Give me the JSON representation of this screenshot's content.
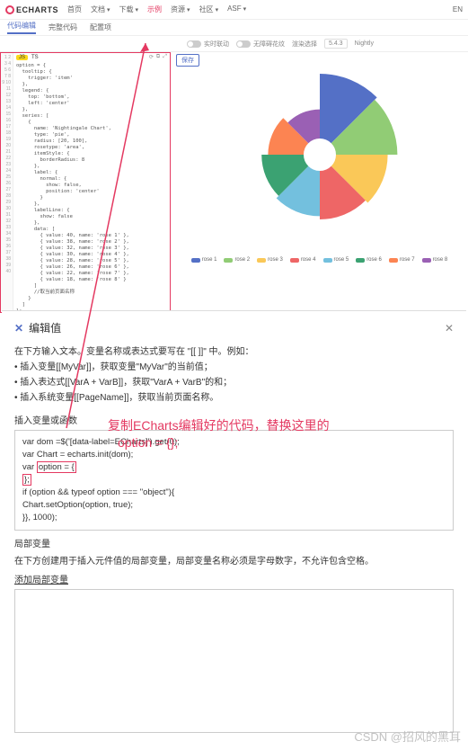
{
  "logo": "ECHARTS",
  "nav": {
    "home": "首页",
    "docs": "文档",
    "docs_dd": true,
    "download": "下载",
    "dl_dd": true,
    "examples": "示例",
    "resources": "资源",
    "res_dd": true,
    "community": "社区",
    "comm_dd": true,
    "asf": "ASF",
    "asf_dd": true
  },
  "lang": "EN",
  "subtabs": {
    "edit": "代码编辑",
    "fullcode": "完整代码",
    "options": "配置项"
  },
  "optbar": {
    "interval": "实时联动",
    "decal": "无障碍花纹",
    "render": "渲染选择",
    "version": "5.4.3",
    "channel": "Nightly"
  },
  "render_opt": "保存",
  "editor": {
    "tabs": {
      "js": "JS",
      "ts": "TS"
    },
    "lines": 40,
    "code": "option = {\n  tooltip: {\n    trigger: 'item'\n  },\n  legend: {\n    top: 'bottom',\n    left: 'center'\n  },\n  series: [\n    {\n      name: 'Nightingale Chart',\n      type: 'pie',\n      radius: [20, 100],\n      rosetype: 'area',\n      itemStyle: {\n        borderRadius: 8\n      },\n      label: {\n        normal: {\n          show: false,\n          position: 'center'\n        }\n      },\n      labelLine: {\n        show: false\n      },\n      data: [\n        { value: 40, name: 'rose 1' },\n        { value: 38, name: 'rose 2' },\n        { value: 32, name: 'rose 3' },\n        { value: 30, name: 'rose 4' },\n        { value: 28, name: 'rose 5' },\n        { value: 26, name: 'rose 6' },\n        { value: 22, name: 'rose 7' },\n        { value: 18, name: 'rose 8' }\n      ]\n      //取当前页面名称\n    }\n  ]\n};"
  },
  "chart_data": {
    "type": "pie",
    "subtype": "rose-area",
    "title": "",
    "radius": [
      20,
      100
    ],
    "series": [
      {
        "name": "Nightingale Chart",
        "data": [
          {
            "name": "rose 1",
            "value": 40,
            "color": "#5470c6"
          },
          {
            "name": "rose 2",
            "value": 38,
            "color": "#91cc75"
          },
          {
            "name": "rose 3",
            "value": 32,
            "color": "#fac858"
          },
          {
            "name": "rose 4",
            "value": 30,
            "color": "#ee6666"
          },
          {
            "name": "rose 5",
            "value": 28,
            "color": "#73c0de"
          },
          {
            "name": "rose 6",
            "value": 26,
            "color": "#3ba272"
          },
          {
            "name": "rose 7",
            "value": 22,
            "color": "#fc8452"
          },
          {
            "name": "rose 8",
            "value": 18,
            "color": "#9a60b4"
          }
        ]
      }
    ],
    "legend": {
      "position": "bottom"
    }
  },
  "dialog": {
    "title": "编辑值",
    "intro_lines": [
      "在下方输入文本。变量名称或表达式要写在 \"[[ ]]\" 中。例如：",
      "• 插入变量[[MyVar]]，获取变量\"MyVar\"的当前值；",
      "• 插入表达式[[VarA + VarB]]，获取\"VarA + VarB\"的和；",
      "• 插入系统变量[[PageName]]，获取当前页面名称。"
    ],
    "label1": "插入变量或函数",
    "code": [
      "var dom =$('[data-label=ECharts]').get(0);",
      "var Chart = echarts.init(dom);",
      "var option = {",
      "};",
      "if (option && typeof option === \"object\"){",
      "Chart.setOption(option, true);",
      "}}, 1000);"
    ],
    "label2": "局部变量",
    "local_desc": "在下方创建用于插入元件值的局部变量，局部变量名称必须是字母数字，不允许包含空格。",
    "add_local": "添加局部变量"
  },
  "annotation": {
    "line1": "复制ECharts编辑好的代码，替换这里的",
    "line2": "option = {};"
  },
  "watermark": "CSDN @招风的黑耳"
}
